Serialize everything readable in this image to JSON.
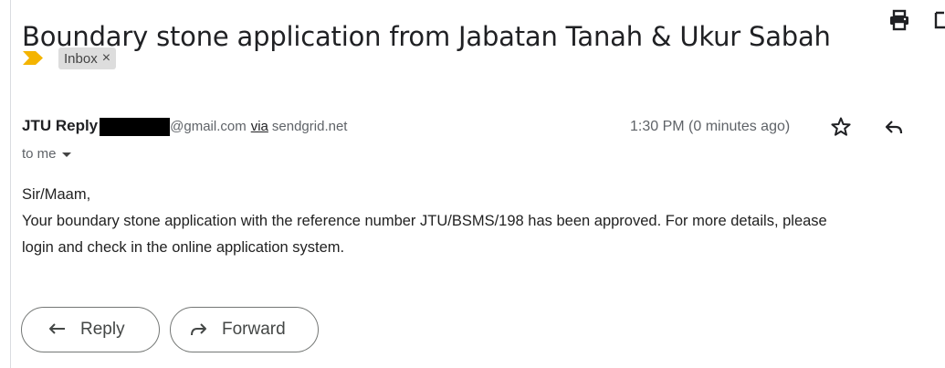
{
  "message": {
    "subject": "Boundary stone application from Jabatan Tanah & Ukur Sabah",
    "label": "Inbox",
    "label_remove": "×",
    "sender_name": "JTU Reply",
    "sender_email_suffix": "@gmail.com",
    "via_label": "via",
    "via_domain": "sendgrid.net",
    "timestamp": "1:30 PM (0 minutes ago)",
    "recipient": "to me",
    "body": {
      "greeting": "Sir/Maam,",
      "line1": "Your boundary stone application with the reference number JTU/BSMS/198 has been approved. For more details, please",
      "line2": "login and check in the online application system."
    }
  },
  "actions": {
    "reply_label": "Reply",
    "forward_label": "Forward"
  },
  "icons": {
    "print": "print-icon",
    "new_window": "open-in-new-window-icon",
    "importance": "importance-marker-icon",
    "star": "star-icon",
    "reply": "reply-icon",
    "forward": "forward-icon",
    "caret": "chevron-down-icon"
  },
  "colors": {
    "importance_marker": "#f4b400",
    "label_chip_bg": "#dddddd",
    "button_border": "#747775"
  }
}
